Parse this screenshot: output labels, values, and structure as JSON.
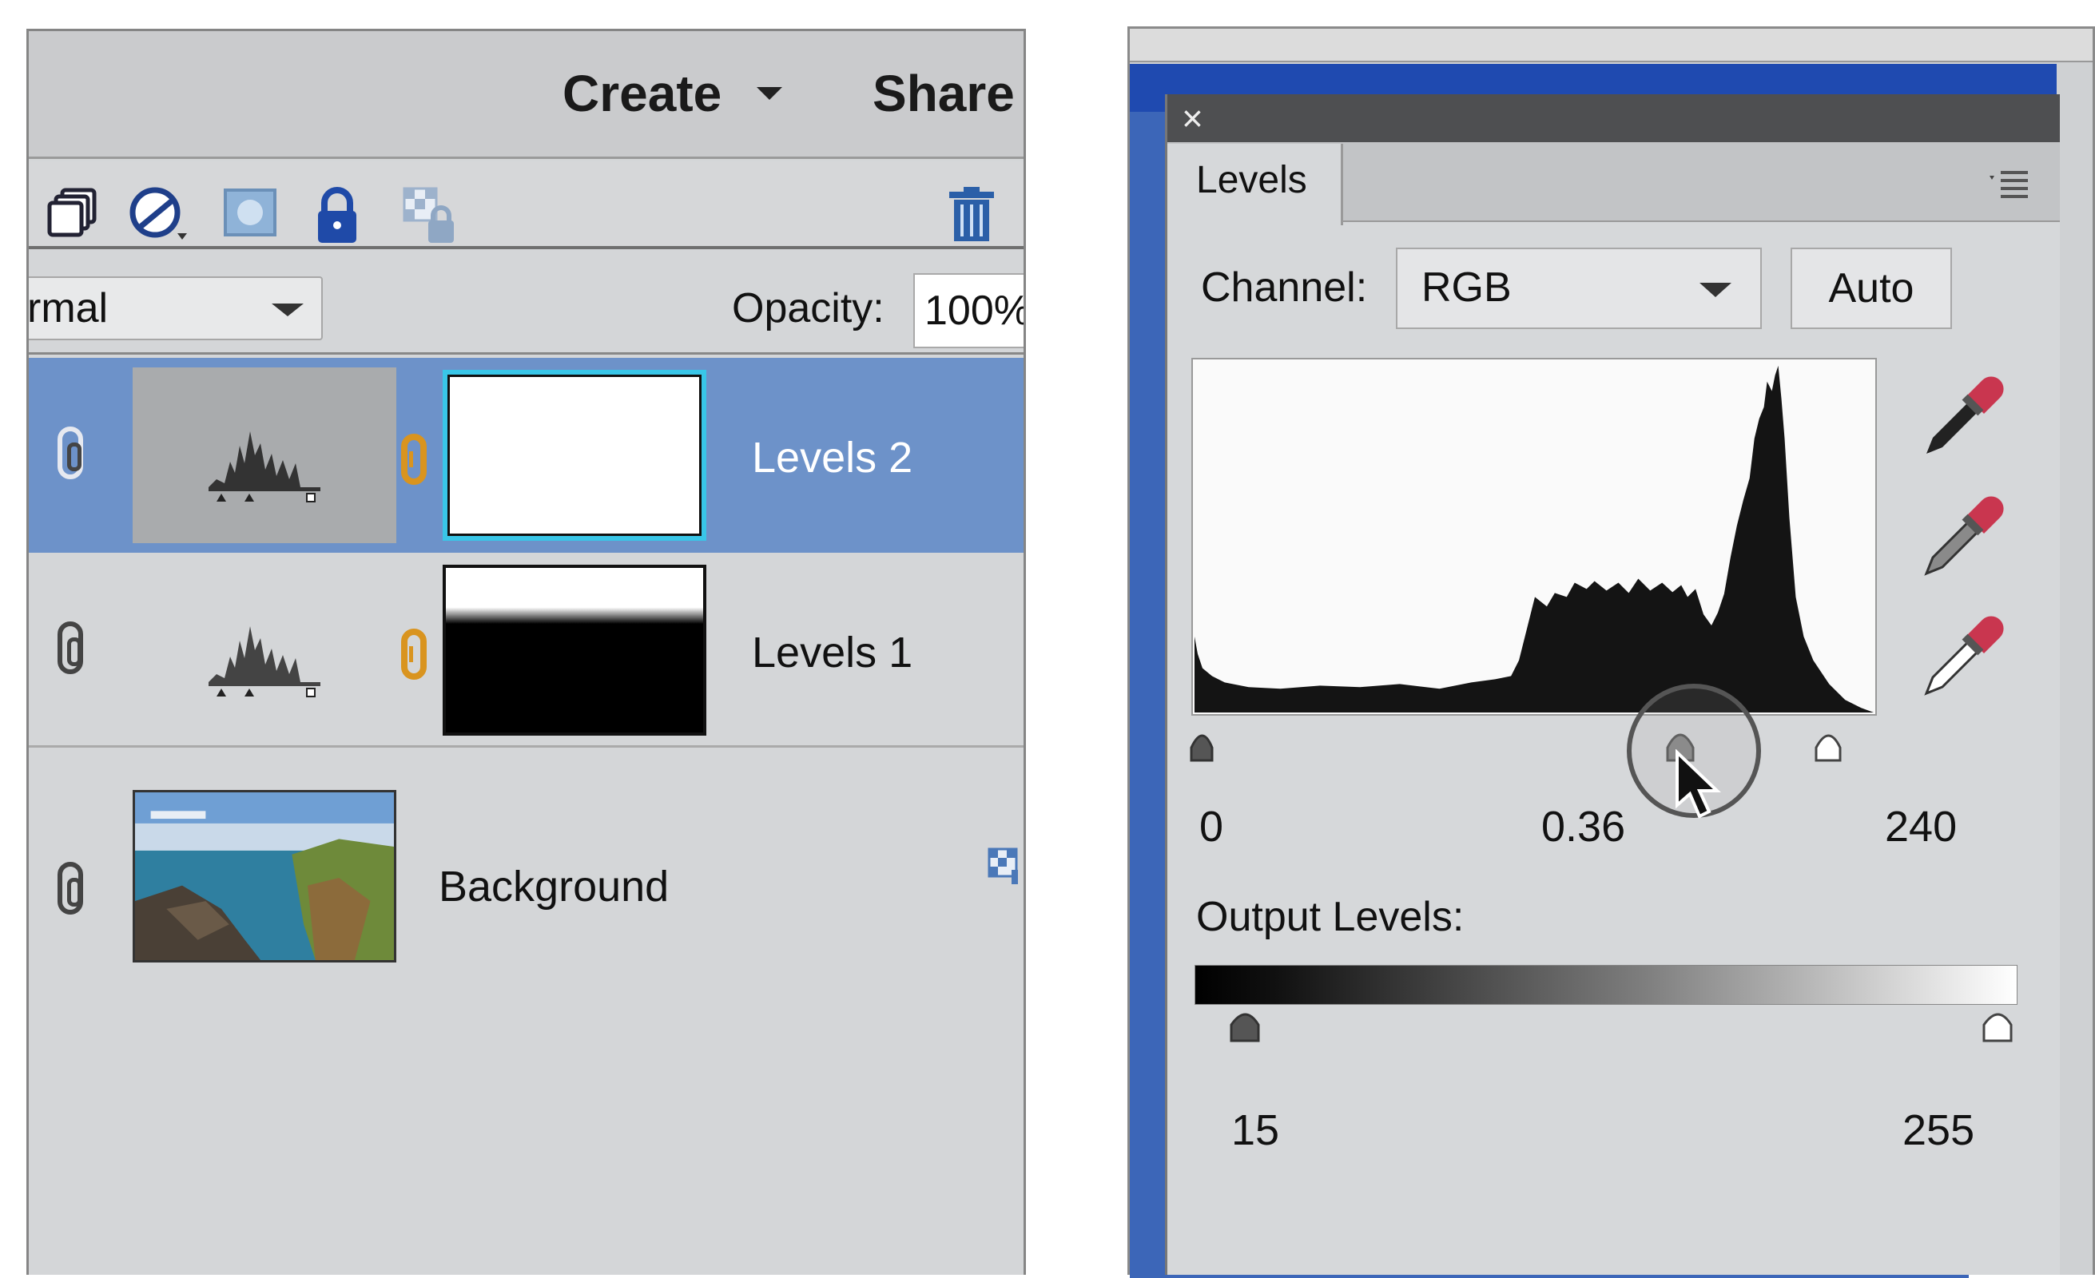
{
  "layers_panel": {
    "menu": {
      "create_label": "Create",
      "share_label": "Share"
    },
    "blend_mode": {
      "visible_value": "rmal"
    },
    "opacity": {
      "label": "Opacity:",
      "value": "100%"
    },
    "layers": [
      {
        "name": "Levels 2",
        "selected": true,
        "type": "levels-adjustment"
      },
      {
        "name": "Levels 1",
        "selected": false,
        "type": "levels-adjustment"
      },
      {
        "name": "Background",
        "selected": false,
        "type": "image"
      }
    ],
    "icons": [
      "new-layer-icon",
      "adjustment-layer-icon",
      "mask-icon",
      "lock-all-icon",
      "lock-transparency-icon",
      "trash-icon",
      "link-icon",
      "visibility-icon",
      "transparency-lock-badge-icon"
    ]
  },
  "levels_dialog": {
    "tab_label": "Levels",
    "channel": {
      "label": "Channel:",
      "value": "RGB"
    },
    "auto_label": "Auto",
    "input_levels": {
      "black": "0",
      "gamma": "0.36",
      "white": "240",
      "gamma_value": 0.36,
      "black_value": 0,
      "white_value": 240
    },
    "output_levels": {
      "label": "Output Levels:",
      "black": "15",
      "white": "255",
      "black_value": 15,
      "white_value": 255
    },
    "eyedroppers": [
      "black-point-eyedropper-icon",
      "gray-point-eyedropper-icon",
      "white-point-eyedropper-icon"
    ],
    "colors": {
      "selection": "#6d92c9",
      "panel": "#d6d8da",
      "histogram_fill": "#141414",
      "eyedropper_tip": "#c9364f"
    }
  }
}
